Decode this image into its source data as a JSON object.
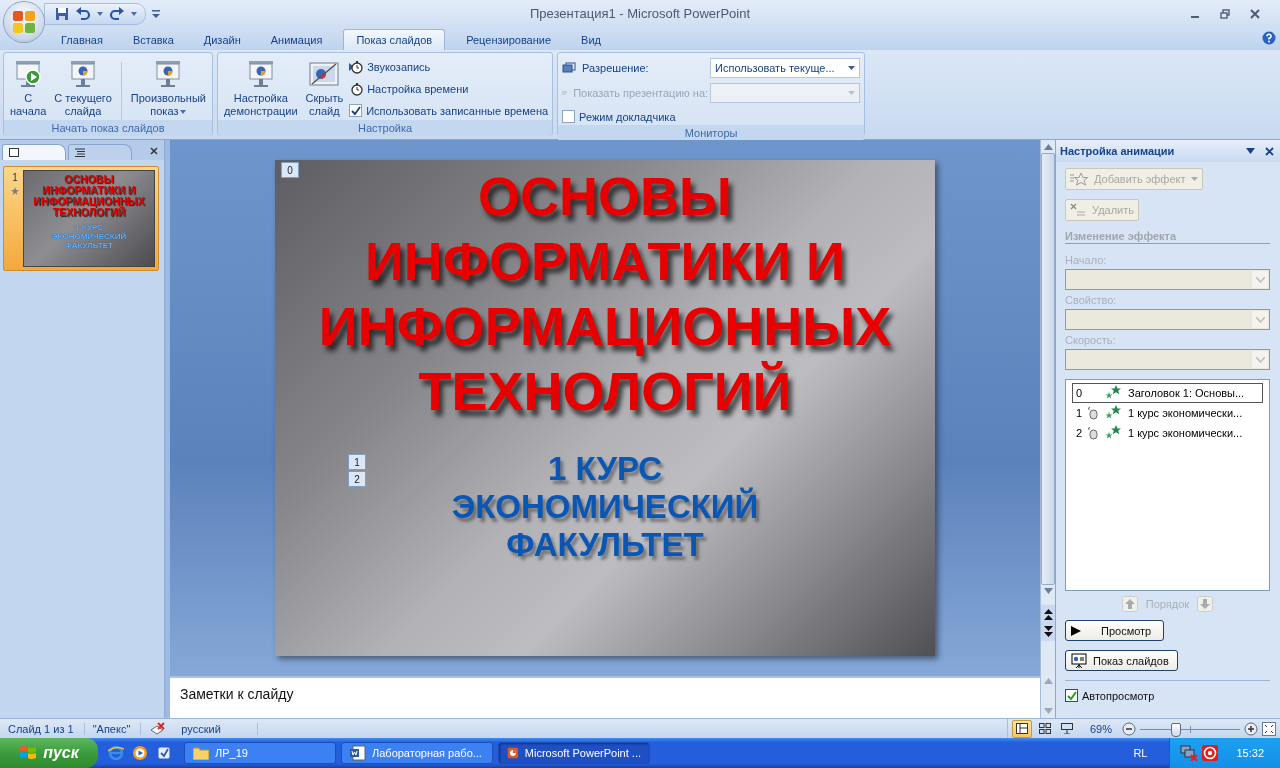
{
  "window": {
    "title": "Презентация1 - Microsoft PowerPoint"
  },
  "tabs": [
    {
      "label": "Главная",
      "selected": false
    },
    {
      "label": "Вставка",
      "selected": false
    },
    {
      "label": "Дизайн",
      "selected": false
    },
    {
      "label": "Анимация",
      "selected": false
    },
    {
      "label": "Показ слайдов",
      "selected": true
    },
    {
      "label": "Рецензирование",
      "selected": false
    },
    {
      "label": "Вид",
      "selected": false
    }
  ],
  "ribbon_groups": [
    {
      "title": "Начать показ слайдов",
      "items": [
        {
          "kind": "large",
          "lines": [
            "С",
            "начала"
          ]
        },
        {
          "kind": "large",
          "lines": [
            "С текущего",
            "слайда"
          ]
        },
        {
          "kind": "large",
          "lines": [
            "Произвольный",
            "показ"
          ],
          "dropdown": true
        }
      ]
    },
    {
      "title": "Настройка",
      "items": [
        {
          "kind": "large",
          "lines": [
            "Настройка",
            "демонстрации"
          ]
        },
        {
          "kind": "large",
          "lines": [
            "Скрыть",
            "слайд"
          ]
        },
        {
          "kind": "small",
          "label": "Звукозапись"
        },
        {
          "kind": "small",
          "label": "Настройка времени"
        },
        {
          "kind": "checkbox",
          "label": "Использовать записанные времена",
          "checked": true
        }
      ]
    },
    {
      "title": "Мониторы",
      "items": [
        {
          "kind": "dropdown",
          "label": "Разрешение:",
          "value": "Использовать текуще...",
          "disabled": false
        },
        {
          "kind": "dropdown",
          "label": "Показать презентацию на:",
          "disabled": true
        },
        {
          "kind": "checkbox",
          "label": "Режим докладчика",
          "checked": false
        }
      ]
    }
  ],
  "slides_pane": {
    "tabs": [
      {
        "selected": true
      },
      {
        "selected": false
      }
    ],
    "thumbnails": [
      {
        "number": "1",
        "selected": true,
        "title": "ОСНОВЫ ИНФОРМАТИКИ И ИНФОРМАЦИОННЫХ ТЕХНОЛОГИЙ",
        "subtitle": "1 КУРС ЭКОНОМИЧЕСКИЙ ФАКУЛЬТЕТ"
      }
    ]
  },
  "slide": {
    "title_tags": [
      "0"
    ],
    "title_lines": [
      "ОСНОВЫ",
      "ИНФОРМАТИКИ И",
      "ИНФОРМАЦИОННЫХ",
      "ТЕХНОЛОГИЙ"
    ],
    "subtitle_tags": [
      "1",
      "2"
    ],
    "subtitle_lines": [
      "1 КУРС",
      "ЭКОНОМИЧЕСКИЙ",
      "ФАКУЛЬТЕТ"
    ]
  },
  "notes": {
    "placeholder": "Заметки к слайду"
  },
  "task_pane": {
    "title": "Настройка анимации",
    "add_effect": {
      "label": "Добавить эффект",
      "disabled": true
    },
    "remove": {
      "label": "Удалить",
      "disabled": true
    },
    "section": "Изменение эффекта",
    "fields": [
      {
        "label": "Начало:",
        "disabled": true
      },
      {
        "label": "Свойство:",
        "disabled": true
      },
      {
        "label": "Скорость:",
        "disabled": true
      }
    ],
    "effects": [
      {
        "order": "0",
        "trigger": false,
        "label": "Заголовок 1: Основы...",
        "selected": true
      },
      {
        "order": "1",
        "trigger": true,
        "label": "1 курс экономически...",
        "selected": false
      },
      {
        "order": "2",
        "trigger": true,
        "label": "1 курс экономически...",
        "selected": false
      }
    ],
    "order": {
      "label": "Порядок",
      "disabled": true
    },
    "preview": "Просмотр",
    "slideshow": "Показ слайдов",
    "autopreview": {
      "label": "Автопросмотр",
      "checked": true
    }
  },
  "status_bar": {
    "slide": "Слайд 1 из 1",
    "theme": "\"Апекс\"",
    "language": "русский",
    "views": [
      {
        "selected": true
      },
      {
        "selected": false
      },
      {
        "selected": false
      }
    ],
    "zoom": {
      "label": "69%",
      "level": 0.35
    }
  },
  "taskbar": {
    "start": "пуск",
    "windows": [
      {
        "label": "ЛР_19",
        "selected": false
      },
      {
        "label": "Лабораторная рабо...",
        "selected": false
      },
      {
        "label": "Microsoft PowerPoint ...",
        "selected": true
      }
    ],
    "language": "RL",
    "clock": "15:32"
  }
}
